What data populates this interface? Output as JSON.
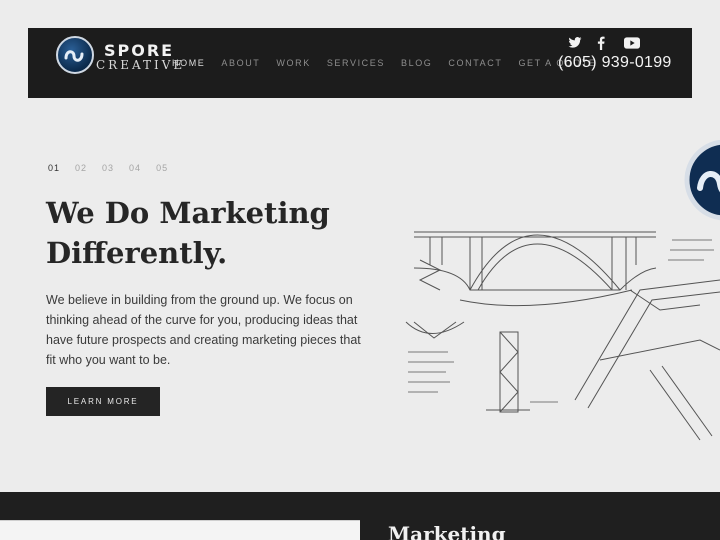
{
  "brand": {
    "name": "SPORE",
    "sub": "CREATIVE"
  },
  "nav": {
    "items": [
      {
        "label": "HOME",
        "active": true
      },
      {
        "label": "ABOUT",
        "active": false
      },
      {
        "label": "WORK",
        "active": false
      },
      {
        "label": "SERVICES",
        "active": false
      },
      {
        "label": "BLOG",
        "active": false
      },
      {
        "label": "CONTACT",
        "active": false
      },
      {
        "label": "GET A QUOTE",
        "active": false
      }
    ]
  },
  "social": {
    "icons": [
      "twitter-icon",
      "facebook-icon",
      "youtube-icon"
    ]
  },
  "contact": {
    "phone": "(605) 939-0199"
  },
  "slider": {
    "pages": [
      "01",
      "02",
      "03",
      "04",
      "05"
    ],
    "active_index": 0
  },
  "hero": {
    "headline_line1": "We Do Marketing",
    "headline_line2": "Differently.",
    "body": "We believe in building from the ground up. We focus on thinking ahead of the curve for you, producing ideas that have future prospects and creating marketing pieces that fit who you want to be.",
    "button_label": "LEARN MORE"
  },
  "next_section": {
    "title": "Marketing"
  },
  "colors": {
    "header_bg": "#1c1c1c",
    "page_bg": "#ececec",
    "button_bg": "#242424",
    "logo_blue": "#1f4f82"
  }
}
